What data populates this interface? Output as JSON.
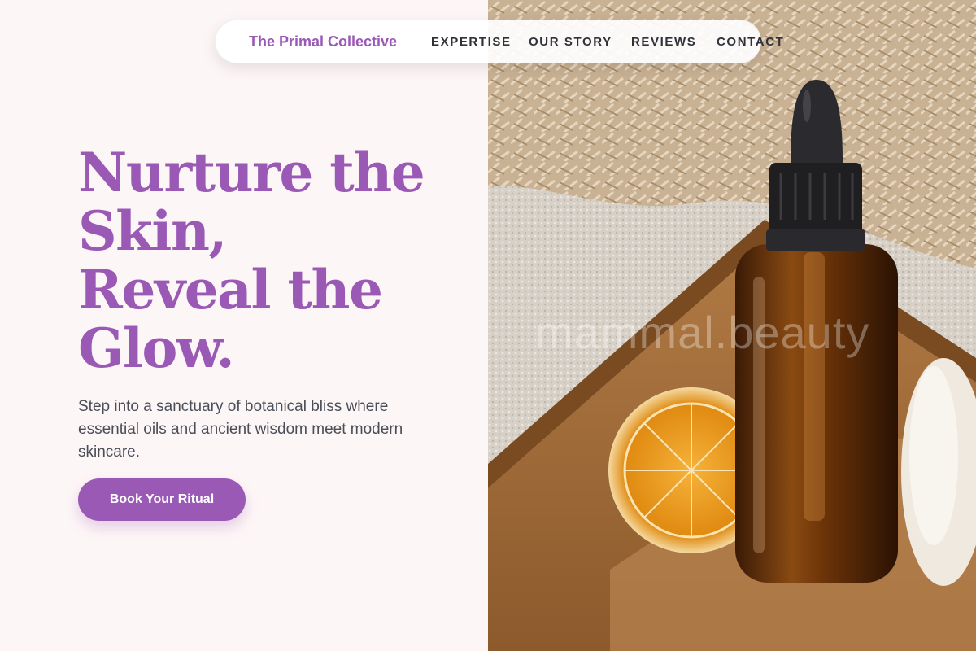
{
  "nav": {
    "brand": "The Primal Collective",
    "links": [
      "EXPERTISE",
      "OUR STORY",
      "REVIEWS",
      "CONTACT"
    ]
  },
  "hero": {
    "headline_lines": [
      "Nurture the",
      "Skin,",
      "Reveal the",
      "Glow."
    ],
    "subtext": "Step into a sanctuary of botanical bliss where essential oils and ancient wisdom meet modern skincare.",
    "cta_label": "Book Your Ritual"
  },
  "image": {
    "watermark": "mammal.beauty"
  },
  "colors": {
    "accent": "#9b59b6",
    "background": "#fdf6f6",
    "text": "#4a4e58",
    "nav_text": "#2f3238"
  }
}
